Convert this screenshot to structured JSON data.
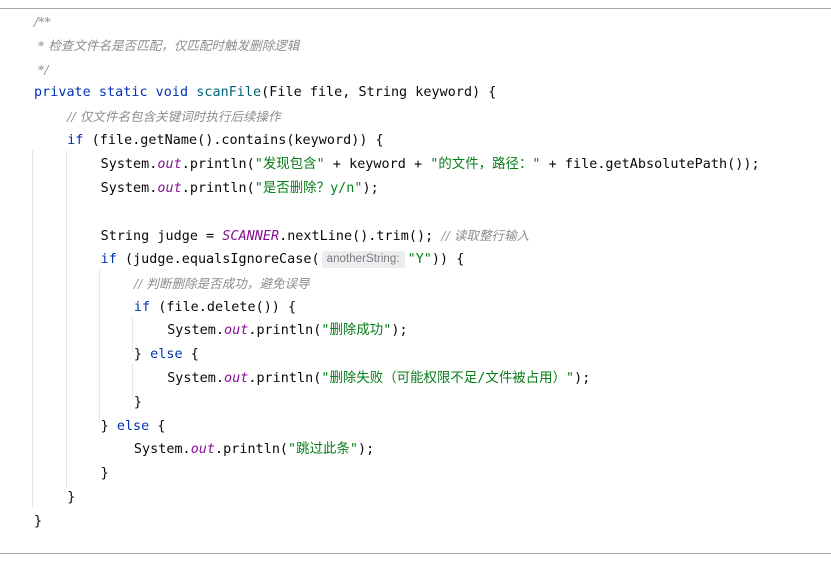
{
  "editor": {
    "language": "java",
    "lines": [
      {
        "indent": 1,
        "segments": [
          {
            "t": "doc",
            "v": "/**"
          }
        ]
      },
      {
        "indent": 1,
        "segments": [
          {
            "t": "doc",
            "v": " * 检查文件名是否匹配，仅匹配时触发删除逻辑"
          }
        ]
      },
      {
        "indent": 1,
        "segments": [
          {
            "t": "doc",
            "v": " */"
          }
        ]
      },
      {
        "indent": 1,
        "segments": [
          {
            "t": "kw",
            "v": "private static void "
          },
          {
            "t": "method",
            "v": "scanFile"
          },
          {
            "t": "plain",
            "v": "(File file, String keyword) {"
          }
        ]
      },
      {
        "indent": 2,
        "segments": [
          {
            "t": "comment",
            "v": "// 仅文件名包含关键词时执行后续操作"
          }
        ]
      },
      {
        "indent": 2,
        "segments": [
          {
            "t": "kw",
            "v": "if "
          },
          {
            "t": "plain",
            "v": "(file.getName().contains(keyword)) {"
          }
        ]
      },
      {
        "indent": 3,
        "segments": [
          {
            "t": "plain",
            "v": "System."
          },
          {
            "t": "field",
            "v": "out"
          },
          {
            "t": "plain",
            "v": ".println("
          },
          {
            "t": "str",
            "v": "\"发现包含\""
          },
          {
            "t": "plain",
            "v": " + keyword + "
          },
          {
            "t": "str",
            "v": "\"的文件，路径：\""
          },
          {
            "t": "plain",
            "v": " + file.getAbsolutePath());"
          }
        ]
      },
      {
        "indent": 3,
        "segments": [
          {
            "t": "plain",
            "v": "System."
          },
          {
            "t": "field",
            "v": "out"
          },
          {
            "t": "plain",
            "v": ".println("
          },
          {
            "t": "str",
            "v": "\"是否删除？y/n\""
          },
          {
            "t": "plain",
            "v": ");"
          }
        ]
      },
      {
        "indent": 3,
        "segments": []
      },
      {
        "indent": 3,
        "segments": [
          {
            "t": "plain",
            "v": "String judge = "
          },
          {
            "t": "const",
            "v": "SCANNER"
          },
          {
            "t": "plain",
            "v": ".nextLine().trim(); "
          },
          {
            "t": "comment",
            "v": "// 读取整行输入"
          }
        ]
      },
      {
        "indent": 3,
        "segments": [
          {
            "t": "kw",
            "v": "if "
          },
          {
            "t": "plain",
            "v": "(judge.equalsIgnoreCase("
          },
          {
            "t": "hint",
            "v": "anotherString:"
          },
          {
            "t": "str",
            "v": "\"Y\""
          },
          {
            "t": "plain",
            "v": ")) {"
          }
        ]
      },
      {
        "indent": 4,
        "segments": [
          {
            "t": "comment",
            "v": "// 判断删除是否成功，避免误导"
          }
        ]
      },
      {
        "indent": 4,
        "segments": [
          {
            "t": "kw",
            "v": "if "
          },
          {
            "t": "plain",
            "v": "(file.delete()) {"
          }
        ]
      },
      {
        "indent": 5,
        "segments": [
          {
            "t": "plain",
            "v": "System."
          },
          {
            "t": "field",
            "v": "out"
          },
          {
            "t": "plain",
            "v": ".println("
          },
          {
            "t": "str",
            "v": "\"删除成功\""
          },
          {
            "t": "plain",
            "v": ");"
          }
        ]
      },
      {
        "indent": 4,
        "segments": [
          {
            "t": "plain",
            "v": "} "
          },
          {
            "t": "kw",
            "v": "else "
          },
          {
            "t": "plain",
            "v": "{"
          }
        ]
      },
      {
        "indent": 5,
        "segments": [
          {
            "t": "plain",
            "v": "System."
          },
          {
            "t": "field",
            "v": "out"
          },
          {
            "t": "plain",
            "v": ".println("
          },
          {
            "t": "str",
            "v": "\"删除失败（可能权限不足/文件被占用）\""
          },
          {
            "t": "plain",
            "v": ");"
          }
        ]
      },
      {
        "indent": 4,
        "segments": [
          {
            "t": "plain",
            "v": "}"
          }
        ]
      },
      {
        "indent": 3,
        "segments": [
          {
            "t": "plain",
            "v": "} "
          },
          {
            "t": "kw",
            "v": "else "
          },
          {
            "t": "plain",
            "v": "{"
          }
        ]
      },
      {
        "indent": 4,
        "segments": [
          {
            "t": "plain",
            "v": "System."
          },
          {
            "t": "field",
            "v": "out"
          },
          {
            "t": "plain",
            "v": ".println("
          },
          {
            "t": "str",
            "v": "\"跳过此条\""
          },
          {
            "t": "plain",
            "v": ");"
          }
        ]
      },
      {
        "indent": 3,
        "segments": [
          {
            "t": "plain",
            "v": "}"
          }
        ]
      },
      {
        "indent": 2,
        "segments": [
          {
            "t": "plain",
            "v": "}"
          }
        ]
      },
      {
        "indent": 1,
        "segments": [
          {
            "t": "plain",
            "v": "}"
          }
        ]
      }
    ]
  },
  "colors": {
    "keyword": "#0033b3",
    "method": "#00627a",
    "string": "#067d17",
    "field": "#871094",
    "comment": "#8c8c8c",
    "text": "#080808",
    "hint_background": "#ebedf0",
    "indent_guide": "#e6e6e6",
    "rule": "#a9a9a9"
  }
}
